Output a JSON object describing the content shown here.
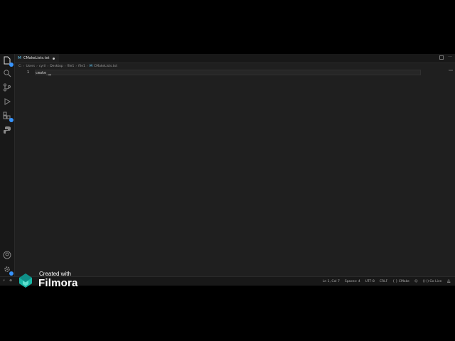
{
  "tab": {
    "icon": "cmake-m-icon",
    "icon_letter": "M",
    "file_name": "CMakeLists.txt"
  },
  "breadcrumb": {
    "items": [
      "C:",
      "Users",
      "cyril",
      "Desktop",
      "file1",
      "file1"
    ],
    "file_icon_letter": "M",
    "file": "CMakeLists.txt"
  },
  "editor": {
    "line_number": "1",
    "line_text": "cmake_"
  },
  "status": {
    "position": "Ln 1, Col 7",
    "spaces": "Spaces: 4",
    "encoding": "UTF-8",
    "eol": "CRLF",
    "language": "CMake",
    "golive": "Go Live"
  },
  "watermark": {
    "created": "Created with",
    "name": "Filmora"
  },
  "colors": {
    "editor_bg": "#1f1f1f",
    "sidebar_bg": "#181818",
    "accent": "#3794ff"
  }
}
